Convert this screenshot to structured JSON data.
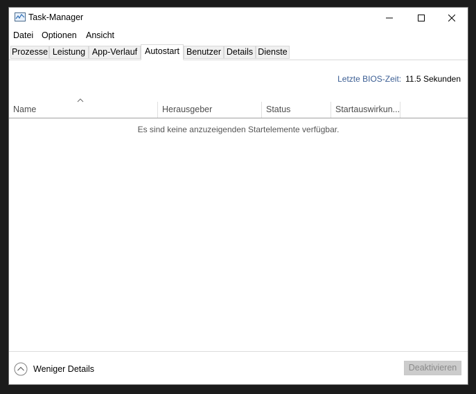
{
  "window": {
    "title": "Task-Manager",
    "app_icon": "task-manager-icon",
    "controls": {
      "minimize": "minimize-icon",
      "maximize": "maximize-icon",
      "close": "close-icon"
    }
  },
  "menu": [
    "Datei",
    "Optionen",
    "Ansicht"
  ],
  "tabs": [
    "Prozesse",
    "Leistung",
    "App-Verlauf",
    "Autostart",
    "Benutzer",
    "Details",
    "Dienste"
  ],
  "active_tab": "Autostart",
  "bios": {
    "label": "Letzte BIOS-Zeit:",
    "value": "11.5 Sekunden"
  },
  "columns": [
    "Name",
    "Herausgeber",
    "Status",
    "Startauswirkun..."
  ],
  "sort": {
    "column": "Name",
    "direction": "ascending"
  },
  "empty_message": "Es sind keine anzuzeigenden Startelemente verfügbar.",
  "footer": {
    "details_toggle": "Weniger Details",
    "deactivate_button": "Deaktivieren"
  },
  "colors": {
    "bios_label": "#3a5d93",
    "window_bg": "#ffffff",
    "desktop_bg": "#1b1b1b"
  }
}
